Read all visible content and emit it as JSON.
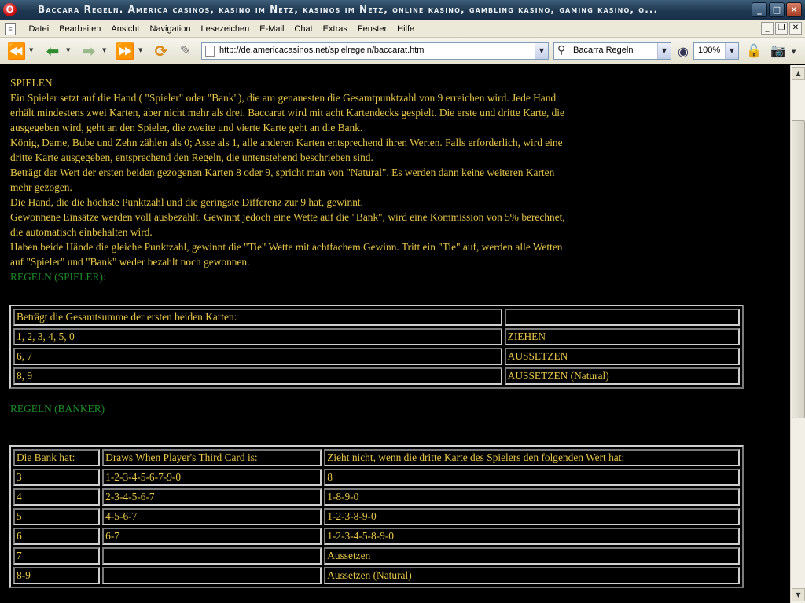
{
  "window": {
    "app_icon": "O",
    "title": "Baccara Regeln. America casinos, kasino im Netz, kasinos im Netz, online kasino, gambling kasino, gaming kasino, o...",
    "minimize_glyph": "_",
    "maximize_glyph": "□",
    "close_glyph": "✕"
  },
  "menu": {
    "items": [
      "Datei",
      "Bearbeiten",
      "Ansicht",
      "Navigation",
      "Lesezeichen",
      "E-Mail",
      "Chat",
      "Extras",
      "Fenster",
      "Hilfe"
    ],
    "mdi_minimize": "_",
    "mdi_restore": "❐",
    "mdi_close": "✕"
  },
  "toolbar": {
    "rewind_icon": "rewind-icon",
    "back_icon": "back-arrow-icon",
    "forward_icon": "forward-arrow-icon",
    "fast_forward_icon": "fast-forward-icon",
    "reload_icon": "reload-icon",
    "edit_icon": "pencil-icon",
    "address": "http://de.americacasinos.net/spielregeln/baccarat.htm",
    "search_value": "Bacarra Regeln",
    "zoom_value": "100%",
    "colors": {
      "back": "#2e8b2e",
      "forward": "#6aa84f",
      "nav_blue": "#2a5db0",
      "reload": "#d98a1a"
    }
  },
  "article": {
    "heading": "SPIELEN",
    "paragraphs": [
      "Ein Spieler setzt auf die Hand ( \"Spieler\" oder \"Bank\"), die am genauesten die Gesamtpunktzahl von 9 erreichen wird. Jede Hand erhält mindestens zwei Karten, aber nicht mehr als drei. Baccarat wird mit acht Kartendecks gespielt. Die erste und dritte Karte, die ausgegeben wird, geht an den Spieler, die zweite und vierte Karte geht an die Bank.",
      "König, Dame, Bube und Zehn zählen als 0; Asse als 1, alle anderen Karten entsprechend ihren Werten. Falls erforderlich, wird eine dritte Karte ausgegeben, entsprechend den Regeln, die untenstehend beschrieben sind.",
      "Beträgt der Wert der ersten beiden gezogenen Karten 8 oder 9, spricht man von \"Natural\". Es werden dann keine weiteren Karten mehr gezogen.",
      "Die Hand, die die höchste Punktzahl und die geringste Differenz zur 9 hat, gewinnt.",
      "Gewonnene Einsätze werden voll ausbezahlt. Gewinnt jedoch eine Wette auf die \"Bank\", wird eine Kommission von 5% berechnet, die automatisch einbehalten wird.",
      "Haben beide Hände die gleiche Punktzahl, gewinnt die \"Tie\" Wette mit achtfachem Gewinn. Tritt ein \"Tie\" auf, werden alle Wetten auf \"Spieler\" und \"Bank\" weder bezahlt noch gewonnen."
    ],
    "text_color": "#e6c64a",
    "section_color": "#1d8a2a"
  },
  "player_rules": {
    "title": "REGELN (SPIELER):",
    "header": [
      "Beträgt die Gesamtsumme der ersten beiden Karten:",
      ""
    ],
    "rows": [
      [
        "1, 2, 3, 4, 5, 0",
        "ZIEHEN"
      ],
      [
        "6, 7",
        "AUSSETZEN"
      ],
      [
        "8, 9",
        "AUSSETZEN (Natural)"
      ]
    ]
  },
  "banker_rules": {
    "title": "REGELN (BANKER)",
    "header": [
      "Die Bank hat:",
      "Draws When Player's Third Card is:",
      "Zieht nicht, wenn die dritte Karte des Spielers den folgenden Wert hat:"
    ],
    "rows": [
      [
        "3",
        "1-2-3-4-5-6-7-9-0",
        "8"
      ],
      [
        "4",
        "2-3-4-5-6-7",
        "1-8-9-0"
      ],
      [
        "5",
        "4-5-6-7",
        "1-2-3-8-9-0"
      ],
      [
        "6",
        "6-7",
        "1-2-3-4-5-8-9-0"
      ],
      [
        "7",
        "",
        "Aussetzen"
      ],
      [
        "8-9",
        "",
        "Aussetzen (Natural)"
      ]
    ]
  }
}
